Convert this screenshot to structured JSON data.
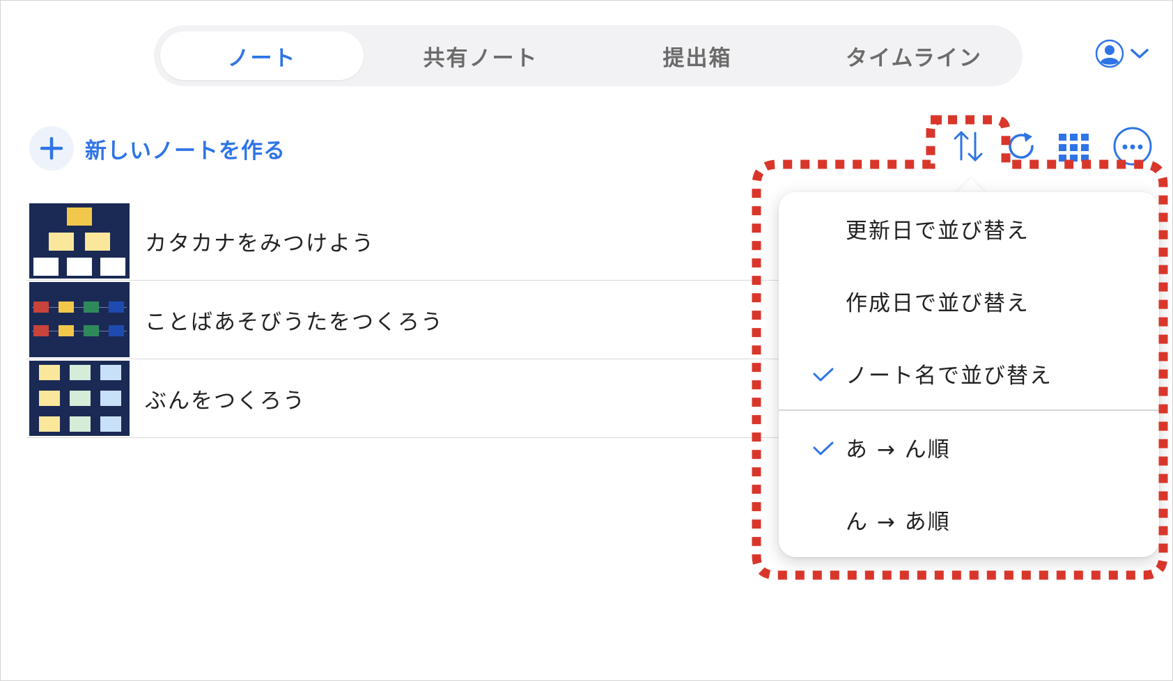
{
  "tabs": [
    {
      "label": "ノート",
      "active": true
    },
    {
      "label": "共有ノート",
      "active": false
    },
    {
      "label": "提出箱",
      "active": false
    },
    {
      "label": "タイムライン",
      "active": false
    }
  ],
  "account": {
    "icon": "user-circle-icon",
    "dropdown_icon": "chevron-down-icon"
  },
  "new_note": {
    "label": "新しいノートを作る",
    "icon": "plus-icon"
  },
  "toolbar": {
    "sort_icon": "sort-arrows-icon",
    "refresh_icon": "refresh-icon",
    "grid_icon": "grid-view-icon",
    "more_icon": "more-options-icon"
  },
  "notes": [
    {
      "title": "カタカナをみつけよう"
    },
    {
      "title": "ことばあそびうたをつくろう"
    },
    {
      "title": "ぶんをつくろう"
    }
  ],
  "sort_menu": {
    "sort_by": [
      {
        "label": "更新日で並び替え",
        "checked": false
      },
      {
        "label": "作成日で並び替え",
        "checked": false
      },
      {
        "label": "ノート名で並び替え",
        "checked": true
      }
    ],
    "order": [
      {
        "label": "あ → ん順",
        "checked": true
      },
      {
        "label": "ん → あ順",
        "checked": false
      }
    ]
  },
  "colors": {
    "accent": "#2e74e6",
    "highlight": "#d9362b",
    "thumb_bg": "#1b2a55"
  }
}
